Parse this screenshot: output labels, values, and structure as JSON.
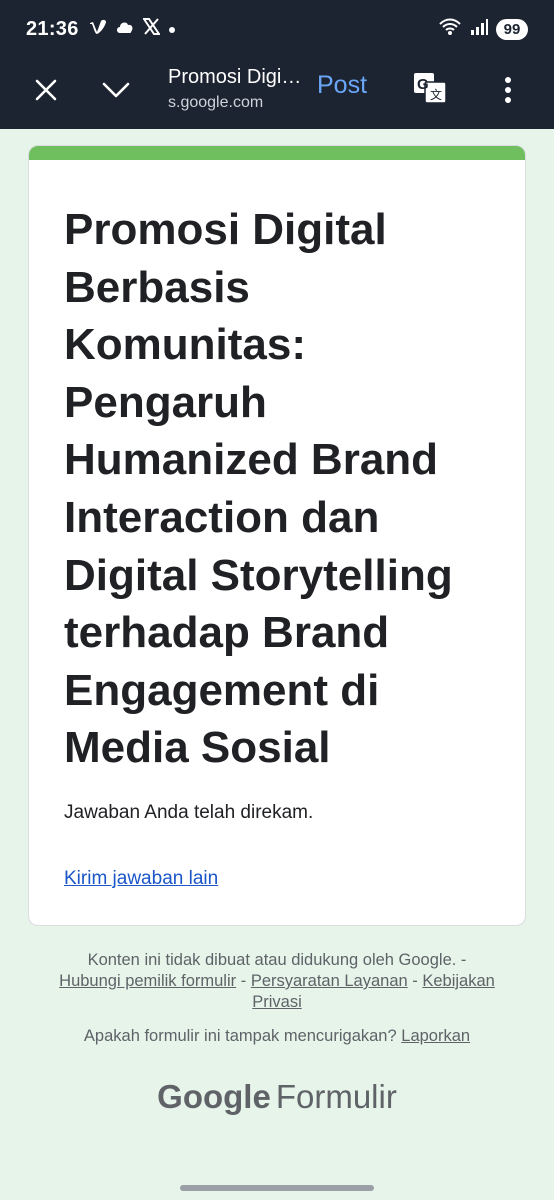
{
  "status_bar": {
    "time": "21:36",
    "left_icons": [
      "vimeo-icon",
      "cloud-icon",
      "x-icon",
      "dot-icon"
    ],
    "right_icons": [
      "wifi-icon",
      "signal-icon"
    ],
    "battery": "99"
  },
  "toolbar": {
    "title": "Promosi Digital Berbasis Komunitas",
    "url": "s.google.com",
    "post_label": "Post",
    "icons": [
      "close-icon",
      "chevron-down-icon",
      "translate-icon",
      "more-vert-icon"
    ]
  },
  "form": {
    "title": "Promosi Digital Berbasis Komunitas: Pengaruh Humanized Brand Interaction dan Digital Storytelling terhadap Brand Engagement di Media Sosial",
    "confirmation": "Jawaban Anda telah direkam.",
    "another_response": "Kirim jawaban lain",
    "accent_color": "#6fbf5f"
  },
  "footer": {
    "disclaimer": "Konten ini tidak dibuat atau didukung oleh Google. -",
    "contact_owner": "Hubungi pemilik formulir",
    "sep1": " - ",
    "terms": "Persyaratan Layanan",
    "sep2": " - ",
    "privacy": "Kebijakan Privasi",
    "report_question": "Apakah formulir ini tampak mencurigakan?",
    "report_link": "Laporkan",
    "brand_google": "Google",
    "brand_product": "Formulir"
  }
}
